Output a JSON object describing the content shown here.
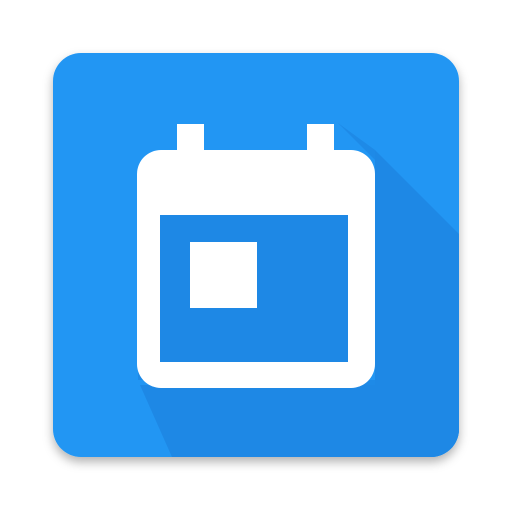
{
  "app_icon": {
    "icon": "calendar-icon",
    "colors": {
      "tile": "#2196F3",
      "tile_shadow": "#1E88E5",
      "glyph": "#FFFFFF"
    }
  }
}
